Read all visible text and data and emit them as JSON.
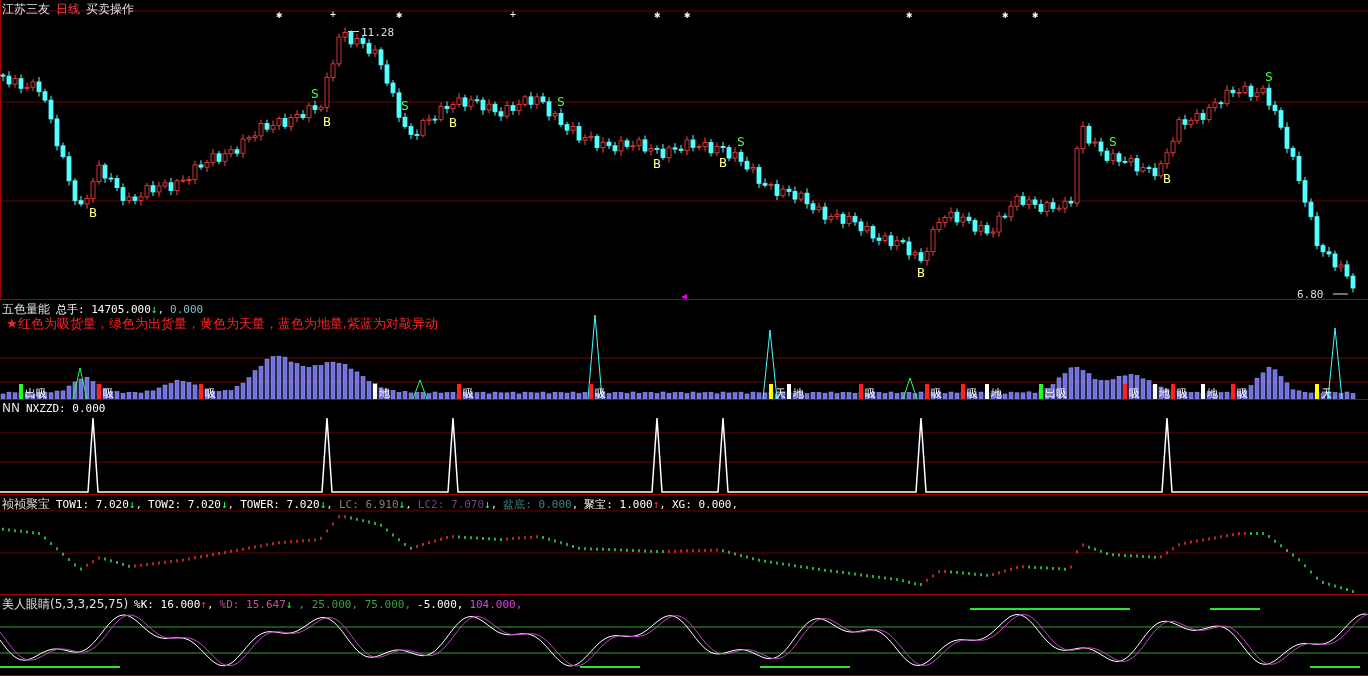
{
  "main_panel": {
    "title": [
      {
        "text": "江苏三友",
        "highlighted": false
      },
      {
        "text": "日线",
        "highlighted": true
      },
      {
        "text": "买卖操作",
        "highlighted": false
      }
    ],
    "high_label": "11.28",
    "low_label": "6.80",
    "top_marks": [
      {
        "symbol": "✱"
      },
      {
        "symbol": "+"
      },
      {
        "symbol": "✱"
      },
      {
        "symbol": "+"
      },
      {
        "symbol": "✱"
      },
      {
        "symbol": "✱"
      },
      {
        "symbol": "✱"
      },
      {
        "symbol": "✱"
      },
      {
        "symbol": "✱"
      }
    ],
    "signals": [
      {
        "text": "B",
        "kind": "buy"
      },
      {
        "text": "S",
        "kind": "sell"
      },
      {
        "text": "B",
        "kind": "buy"
      },
      {
        "text": "S",
        "kind": "sell"
      },
      {
        "text": "B",
        "kind": "buy"
      },
      {
        "text": "S",
        "kind": "sell"
      },
      {
        "text": "B",
        "kind": "buy"
      },
      {
        "text": "B",
        "kind": "buy"
      },
      {
        "text": "S",
        "kind": "sell"
      },
      {
        "text": "B",
        "kind": "buy"
      },
      {
        "text": "S",
        "kind": "sell"
      },
      {
        "text": "B",
        "kind": "buy"
      },
      {
        "text": "S",
        "kind": "sell"
      }
    ]
  },
  "volume_panel": {
    "title": "五色量能",
    "items": [
      {
        "text": "总手: 14705.000",
        "arrow": {
          "symbol": "↓",
          "rising": false
        },
        "color": "#ffffff",
        "trail": ","
      },
      {
        "text": "0.000",
        "color": "#80c0c0"
      }
    ],
    "legend": "★红色为吸货量，绿色为出货量，黄色为天量，蓝色为地量,紫蓝为对敲异动",
    "labels": [
      {
        "text": "出吸",
        "color": "#20ff20"
      },
      {
        "text": "吸",
        "color": "#ff2020"
      },
      {
        "text": "吸",
        "color": "#ff2020"
      },
      {
        "text": "地",
        "color": "#ffffff"
      },
      {
        "text": "吸",
        "color": "#ff2020"
      },
      {
        "text": "吸",
        "color": "#ff2020"
      },
      {
        "text": "天",
        "color": "#ffff00"
      },
      {
        "text": "地",
        "color": "#ffffff"
      },
      {
        "text": "吸",
        "color": "#ff2020"
      },
      {
        "text": "吸",
        "color": "#ff2020"
      },
      {
        "text": "吸",
        "color": "#ff2020"
      },
      {
        "text": "地",
        "color": "#ffffff"
      },
      {
        "text": "出吸",
        "color": "#20ff20"
      },
      {
        "text": "吸",
        "color": "#ff2020"
      },
      {
        "text": "地",
        "color": "#ffffff"
      },
      {
        "text": "吸",
        "color": "#ff2020"
      },
      {
        "text": "地",
        "color": "#ffffff"
      },
      {
        "text": "吸",
        "color": "#ff2020"
      },
      {
        "text": "天",
        "color": "#ffff00"
      }
    ]
  },
  "nn_panel": {
    "title": "NN",
    "items": [
      {
        "text": "NXZZD: 0.000",
        "color": "#ffffff"
      }
    ]
  },
  "jubao_panel": {
    "title": "祯祯聚宝",
    "items": [
      {
        "text": "TOW1: 7.020",
        "arrow": {
          "symbol": "↓",
          "rising": false
        },
        "color": "#ffffff",
        "trail": ","
      },
      {
        "text": "TOW2: 7.020",
        "arrow": {
          "symbol": "↓",
          "rising": false
        },
        "color": "#ffffff",
        "trail": ","
      },
      {
        "text": "TOWER: 7.020",
        "arrow": {
          "symbol": "↓",
          "rising": false
        },
        "color": "#ffffff",
        "trail": ","
      },
      {
        "text": "LC: 6.910",
        "arrow": {
          "symbol": "↓",
          "rising": false
        },
        "color": "#808080",
        "trail": ","
      },
      {
        "text": "LC2: 7.070",
        "arrow": {
          "symbol": "↓",
          "rising": false
        },
        "color": "#804080",
        "trail": ","
      },
      {
        "text": "盆底: 0.000",
        "color": "#408080",
        "trail": ","
      },
      {
        "text": "聚宝: 1.000",
        "arrow": {
          "symbol": "↑",
          "rising": true
        },
        "color": "#ffffff",
        "trail": ","
      },
      {
        "text": "XG: 0.000",
        "color": "#ffffff",
        "trail": ","
      }
    ]
  },
  "eyes_panel": {
    "title": "美人眼睛(5,3,3,25,75)",
    "items": [
      {
        "text": "%K: 16.000",
        "arrow": {
          "symbol": "↑",
          "rising": true
        },
        "color": "#ffffff",
        "trail": ","
      },
      {
        "text": "%D: 15.647",
        "arrow": {
          "symbol": "↓",
          "rising": false
        },
        "color": "#c050a0"
      },
      {
        "text": ", 25.000, 75.000,",
        "color": "#40a040"
      },
      {
        "text": "-5.000,",
        "color": "#ffffff"
      },
      {
        "text": "104.000,",
        "color": "#e040e0"
      }
    ]
  }
}
